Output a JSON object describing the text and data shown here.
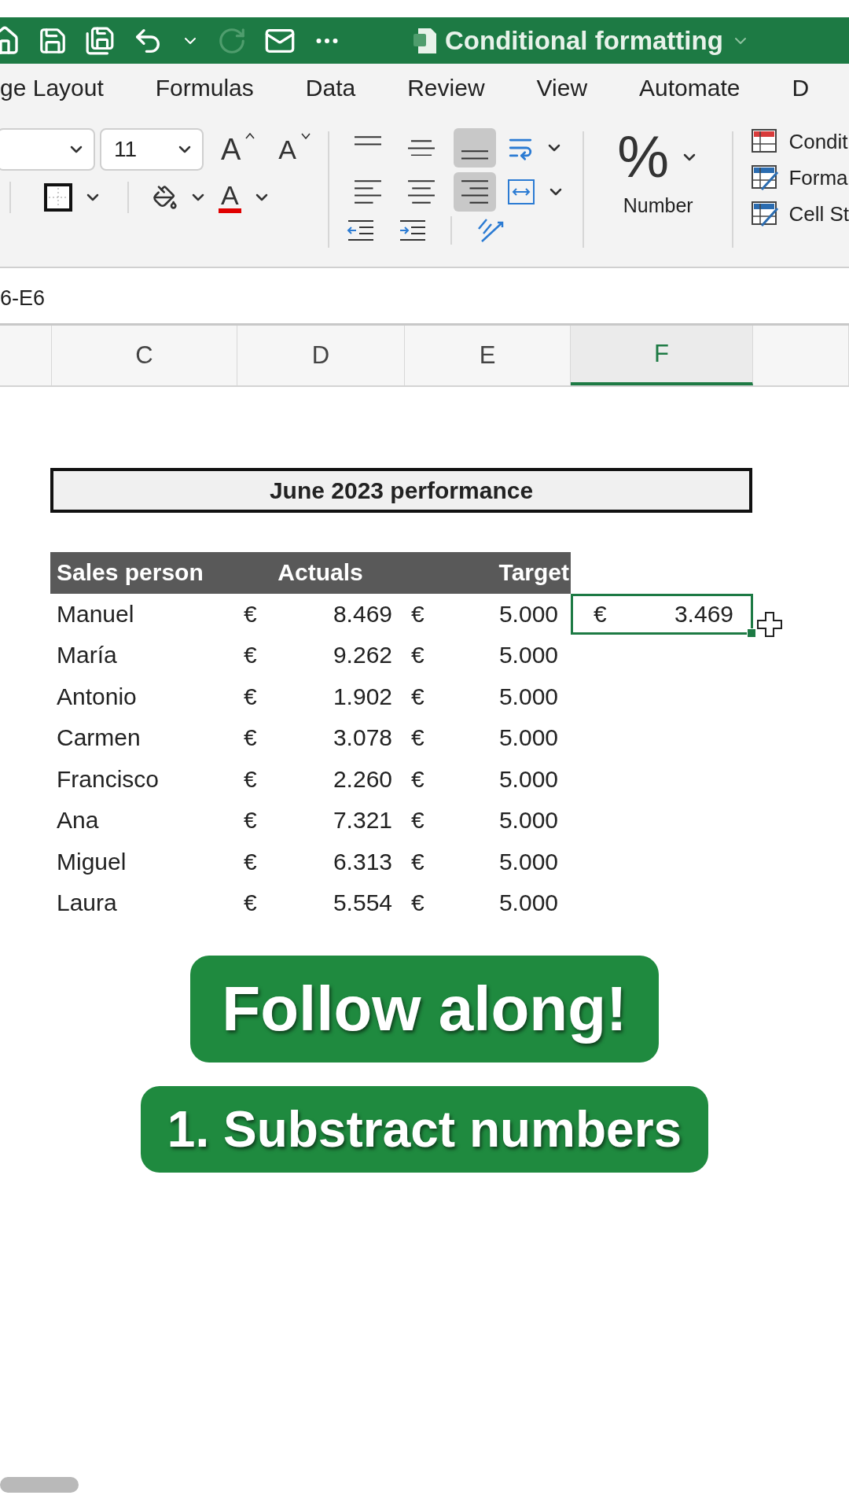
{
  "title_bar": {
    "title": "Conditional formatting"
  },
  "menu_tabs": [
    {
      "label": "ge Layout",
      "selected": false
    },
    {
      "label": "Formulas",
      "selected": false
    },
    {
      "label": "Data",
      "selected": false
    },
    {
      "label": "Review",
      "selected": false
    },
    {
      "label": "View",
      "selected": false
    },
    {
      "label": "Automate",
      "selected": false
    },
    {
      "label": "D",
      "selected": false
    }
  ],
  "ribbon": {
    "font_size": "11",
    "grow_glyph": "A",
    "shrink_glyph": "A",
    "font_color_glyph": "A",
    "alignment": [
      {
        "kind": "top",
        "selected": false
      },
      {
        "kind": "middle",
        "selected": false
      },
      {
        "kind": "bottom",
        "selected": true
      },
      {
        "kind": "left",
        "selected": false
      },
      {
        "kind": "center",
        "selected": false
      },
      {
        "kind": "right",
        "selected": true
      }
    ],
    "number_symbol": "%",
    "number_label": "Number",
    "styles": [
      {
        "kind": "conditional",
        "label": "Condit"
      },
      {
        "kind": "table",
        "label": "Forma"
      },
      {
        "kind": "cell",
        "label": "Cell St"
      }
    ]
  },
  "formula_bar": {
    "value": "6-E6"
  },
  "columns": [
    {
      "label": "C",
      "selected": false
    },
    {
      "label": "D",
      "selected": false
    },
    {
      "label": "E",
      "selected": false
    },
    {
      "label": "F",
      "selected": true
    }
  ],
  "sheet": {
    "title": "June 2023 performance",
    "headers": [
      "Sales person",
      "Actuals",
      "Target"
    ],
    "rows": [
      {
        "name": "Manuel",
        "actual_currency": "€",
        "actual": "8.469",
        "target_currency": "€",
        "target": "5.000"
      },
      {
        "name": "María",
        "actual_currency": "€",
        "actual": "9.262",
        "target_currency": "€",
        "target": "5.000"
      },
      {
        "name": "Antonio",
        "actual_currency": "€",
        "actual": "1.902",
        "target_currency": "€",
        "target": "5.000"
      },
      {
        "name": "Carmen",
        "actual_currency": "€",
        "actual": "3.078",
        "target_currency": "€",
        "target": "5.000"
      },
      {
        "name": "Francisco",
        "actual_currency": "€",
        "actual": "2.260",
        "target_currency": "€",
        "target": "5.000"
      },
      {
        "name": "Ana",
        "actual_currency": "€",
        "actual": "7.321",
        "target_currency": "€",
        "target": "5.000"
      },
      {
        "name": "Miguel",
        "actual_currency": "€",
        "actual": "6.313",
        "target_currency": "€",
        "target": "5.000"
      },
      {
        "name": "Laura",
        "actual_currency": "€",
        "actual": "5.554",
        "target_currency": "€",
        "target": "5.000"
      }
    ],
    "result_cell": {
      "currency": "€",
      "value": "3.469",
      "selected": true
    }
  },
  "captions": [
    "Follow along!",
    "1. Substract numbers"
  ]
}
